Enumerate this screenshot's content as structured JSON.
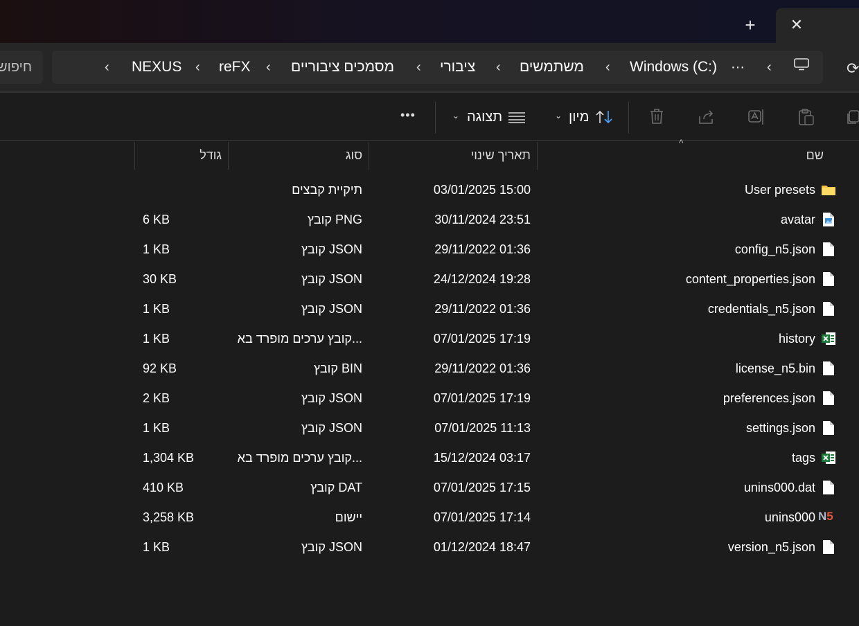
{
  "window": {
    "new_tab_label": "+",
    "close_tab_label": "✕"
  },
  "address": {
    "search_placeholder": "חיפוש",
    "overflow": "···",
    "breadcrumbs": [
      "Windows (C:)",
      "משתמשים",
      "ציבורי",
      "מסמכים ציבוריים",
      "reFX",
      "NEXUS"
    ]
  },
  "toolbar": {
    "sort_label": "מיון",
    "view_label": "תצוגה",
    "more_label": "•••"
  },
  "columns": {
    "name": "שם",
    "date": "תאריך שינוי",
    "type": "סוג",
    "size": "גודל"
  },
  "files": [
    {
      "name": "User presets",
      "date": "03/01/2025 15:00",
      "type": "תיקיית קבצים",
      "size": "",
      "icon": "folder-icon"
    },
    {
      "name": "avatar",
      "date": "30/11/2024 23:51",
      "type": "קובץ PNG",
      "size": "6 KB",
      "icon": "image-file-icon"
    },
    {
      "name": "config_n5.json",
      "date": "29/11/2022 01:36",
      "type": "קובץ JSON",
      "size": "1 KB",
      "icon": "file-icon"
    },
    {
      "name": "content_properties.json",
      "date": "24/12/2024 19:28",
      "type": "קובץ JSON",
      "size": "30 KB",
      "icon": "file-icon"
    },
    {
      "name": "credentials_n5.json",
      "date": "29/11/2022 01:36",
      "type": "קובץ JSON",
      "size": "1 KB",
      "icon": "file-icon"
    },
    {
      "name": "history",
      "date": "07/01/2025 17:19",
      "type": "קובץ ערכים מופרד בא...",
      "size": "1 KB",
      "icon": "excel-file-icon"
    },
    {
      "name": "license_n5.bin",
      "date": "29/11/2022 01:36",
      "type": "קובץ BIN",
      "size": "92 KB",
      "icon": "file-icon"
    },
    {
      "name": "preferences.json",
      "date": "07/01/2025 17:19",
      "type": "קובץ JSON",
      "size": "2 KB",
      "icon": "file-icon"
    },
    {
      "name": "settings.json",
      "date": "07/01/2025 11:13",
      "type": "קובץ JSON",
      "size": "1 KB",
      "icon": "file-icon"
    },
    {
      "name": "tags",
      "date": "15/12/2024 03:17",
      "type": "קובץ ערכים מופרד בא...",
      "size": "1,304 KB",
      "icon": "excel-file-icon"
    },
    {
      "name": "unins000.dat",
      "date": "07/01/2025 17:15",
      "type": "קובץ DAT",
      "size": "410 KB",
      "icon": "file-icon"
    },
    {
      "name": "unins000",
      "date": "07/01/2025 17:14",
      "type": "יישום",
      "size": "3,258 KB",
      "icon": "n5-app-icon",
      "icon_text": "N5"
    },
    {
      "name": "version_n5.json",
      "date": "01/12/2024 18:47",
      "type": "קובץ JSON",
      "size": "1 KB",
      "icon": "file-icon"
    }
  ],
  "colors": {
    "folder": "#f4c542",
    "excel": "#1d7a3c",
    "n5_n": "#b0b8c8",
    "n5_5": "#e2553a",
    "accent": "#4da3ff"
  }
}
